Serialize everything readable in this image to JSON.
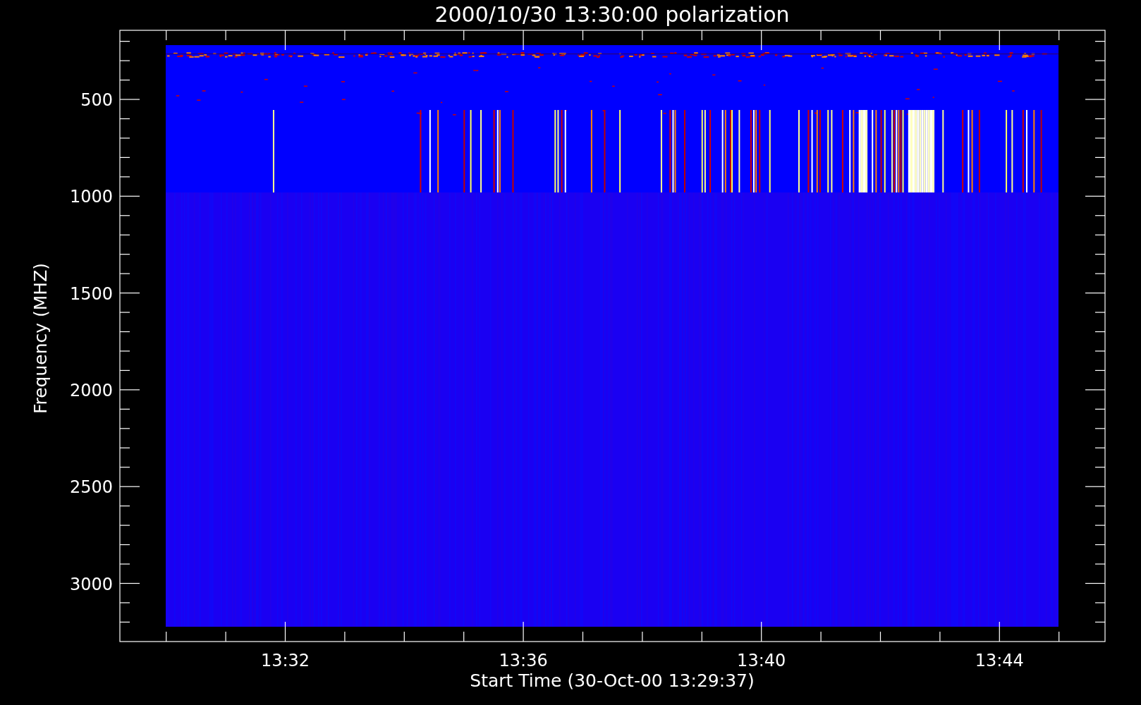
{
  "plot": {
    "title": "2000/10/30 13:30:00 polarization",
    "xlabel": "Start Time (30-Oct-00 13:29:37)",
    "ylabel": "Frequency (MHZ)",
    "xtick_labels": [
      "13:32",
      "13:36",
      "13:40",
      "13:44"
    ],
    "ytick_labels": [
      "500",
      "1000",
      "1500",
      "2000",
      "2500",
      "3000"
    ]
  }
}
